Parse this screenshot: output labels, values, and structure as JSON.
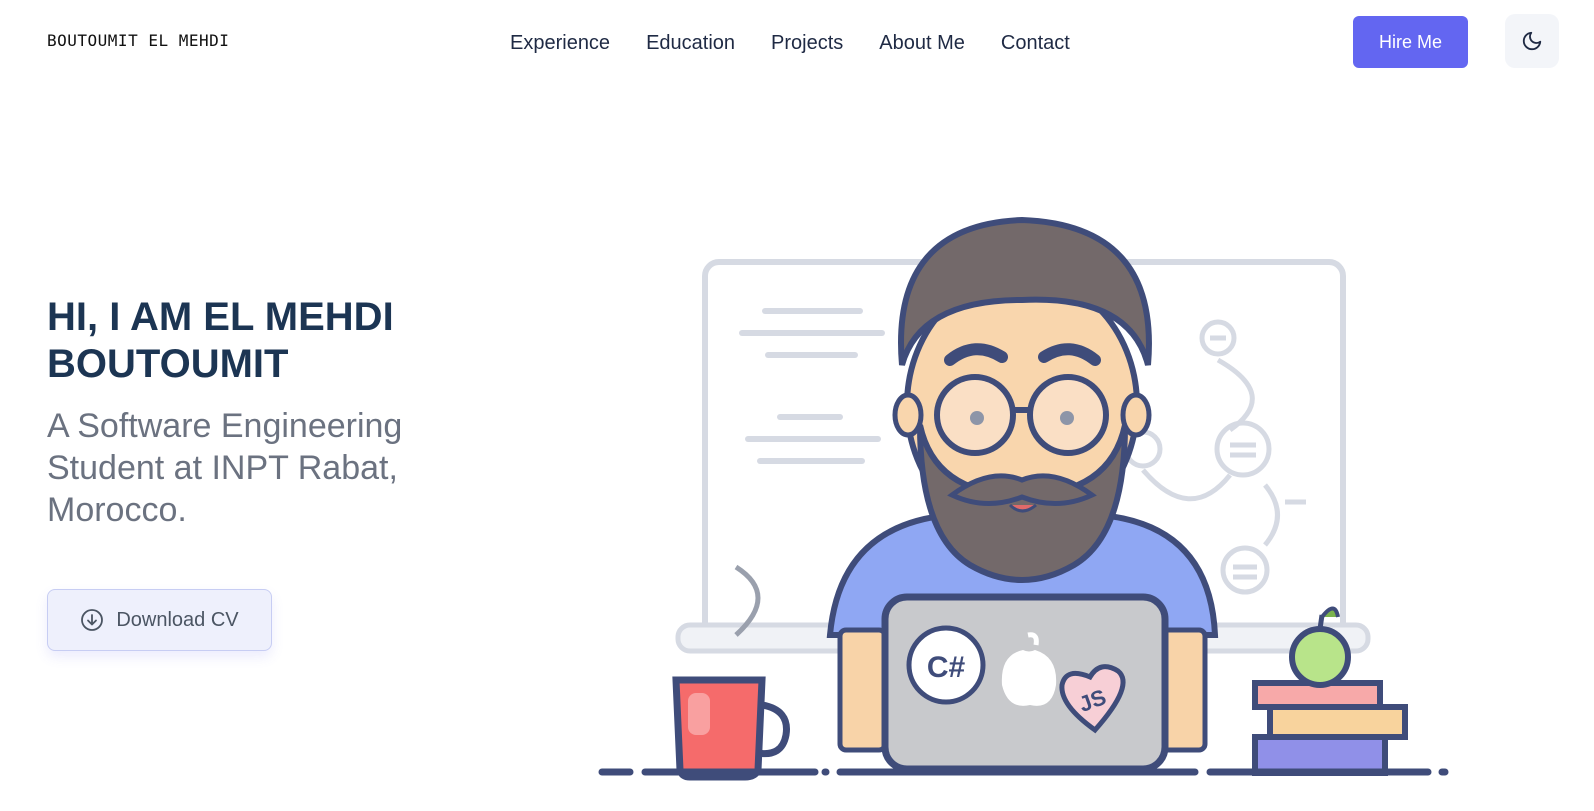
{
  "header": {
    "logo": "BOUTOUMIT EL MEHDI",
    "nav": [
      "Experience",
      "Education",
      "Projects",
      "About Me",
      "Contact"
    ],
    "hire_label": "Hire Me",
    "theme_icon": "moon-icon"
  },
  "hero": {
    "title_line1": "HI, I AM EL MEHDI",
    "title_line2": "BOUTOUMIT",
    "subtitle": "A Software Engineering Student at INPT Rabat, Morocco.",
    "download_label": "Download CV",
    "download_icon": "download-circle-icon"
  },
  "illustration": {
    "laptop_sticker_1": "C#",
    "laptop_sticker_2": "JS"
  },
  "colors": {
    "accent": "#6366f1",
    "title": "#1c3553",
    "subtitle": "#6b7280"
  }
}
